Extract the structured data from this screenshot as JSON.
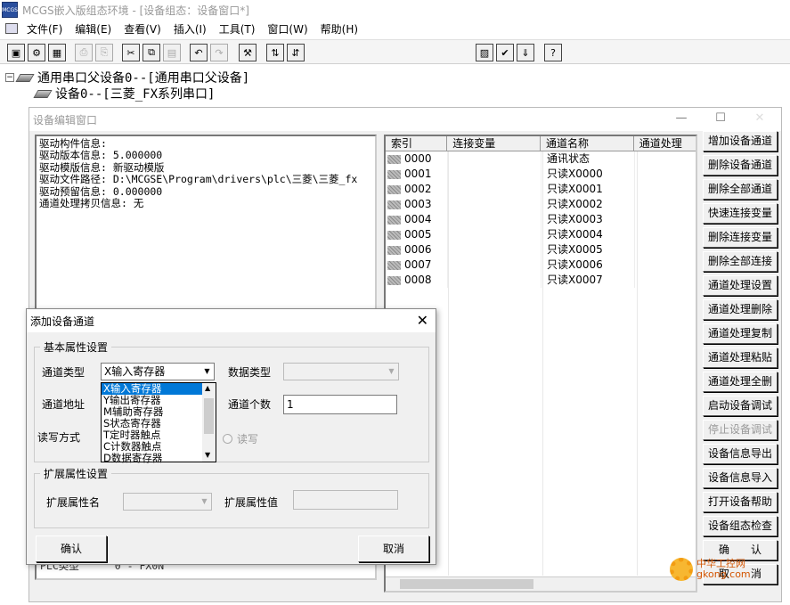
{
  "window": {
    "icon_text": "MCGS",
    "title": "MCGS嵌入版组态环境 - [设备组态：设备窗口*]"
  },
  "menu": [
    "文件(F)",
    "编辑(E)",
    "查看(V)",
    "插入(I)",
    "工具(T)",
    "窗口(W)",
    "帮助(H)"
  ],
  "toolbar": {
    "glyphs": [
      "▣",
      "⚙",
      "▦",
      "⎙",
      "⎘",
      "✂",
      "⧉",
      "▤",
      "↶",
      "↷",
      "⚒",
      "⇅",
      "⇵",
      "▨",
      "✔",
      "⇓",
      "?"
    ]
  },
  "tree": {
    "parent": "通用串口父设备0--[通用串口父设备]",
    "toggle": "−",
    "child": "设备0--[三菱_FX系列串口]"
  },
  "device_window": {
    "title": "设备编辑窗口",
    "minimize": "—",
    "maximize": "☐",
    "close": "✕",
    "driver_info": [
      "驱动构件信息:",
      "驱动版本信息: 5.000000",
      "驱动模版信息: 新驱动模版",
      "驱动文件路径: D:\\MCGSE\\Program\\drivers\\plc\\三菱\\三菱_fx",
      "驱动预留信息: 0.000000",
      "通道处理拷贝信息: 无"
    ],
    "hidden_row": {
      "label": "PLC类型",
      "value": "0 - FX0N"
    },
    "grid_headers": [
      "索引",
      "连接变量",
      "通道名称",
      "通道处理"
    ],
    "channels": [
      {
        "index": "0000",
        "var": "",
        "name": "通讯状态",
        "proc": ""
      },
      {
        "index": "0001",
        "var": "",
        "name": "只读X0000",
        "proc": ""
      },
      {
        "index": "0002",
        "var": "",
        "name": "只读X0001",
        "proc": ""
      },
      {
        "index": "0003",
        "var": "",
        "name": "只读X0002",
        "proc": ""
      },
      {
        "index": "0004",
        "var": "",
        "name": "只读X0003",
        "proc": ""
      },
      {
        "index": "0005",
        "var": "",
        "name": "只读X0004",
        "proc": ""
      },
      {
        "index": "0006",
        "var": "",
        "name": "只读X0005",
        "proc": ""
      },
      {
        "index": "0007",
        "var": "",
        "name": "只读X0006",
        "proc": ""
      },
      {
        "index": "0008",
        "var": "",
        "name": "只读X0007",
        "proc": ""
      }
    ],
    "buttons": [
      {
        "label": "增加设备通道",
        "enabled": true
      },
      {
        "label": "删除设备通道",
        "enabled": true
      },
      {
        "label": "删除全部通道",
        "enabled": true
      },
      {
        "label": "快速连接变量",
        "enabled": true
      },
      {
        "label": "删除连接变量",
        "enabled": true
      },
      {
        "label": "删除全部连接",
        "enabled": true
      },
      {
        "label": "通道处理设置",
        "enabled": true
      },
      {
        "label": "通道处理删除",
        "enabled": true
      },
      {
        "label": "通道处理复制",
        "enabled": true
      },
      {
        "label": "通道处理粘贴",
        "enabled": true
      },
      {
        "label": "通道处理全删",
        "enabled": true
      },
      {
        "label": "启动设备调试",
        "enabled": true
      },
      {
        "label": "停止设备调试",
        "enabled": false
      },
      {
        "label": "设备信息导出",
        "enabled": true
      },
      {
        "label": "设备信息导入",
        "enabled": true
      },
      {
        "label": "打开设备帮助",
        "enabled": true
      },
      {
        "label": "设备组态检查",
        "enabled": true
      },
      {
        "label": "确　　认",
        "enabled": true
      },
      {
        "label": "取　　消",
        "enabled": true
      }
    ]
  },
  "dialog": {
    "title": "添加设备通道",
    "close": "✕",
    "basic_group": "基本属性设置",
    "channel_type_label": "通道类型",
    "channel_type_value": "X输入寄存器",
    "data_type_label": "数据类型",
    "data_type_value": "",
    "channel_addr_label": "通道地址",
    "channel_count_label": "通道个数",
    "channel_count_value": "1",
    "rw_label": "读写方式",
    "rw_option": "读写",
    "dropdown_options": [
      "X输入寄存器",
      "Y输出寄存器",
      "M辅助寄存器",
      "S状态寄存器",
      "T定时器触点",
      "C计数器触点",
      "D数据寄存器"
    ],
    "ext_group": "扩展属性设置",
    "ext_name_label": "扩展属性名",
    "ext_value_label": "扩展属性值",
    "ok": "确认",
    "cancel": "取消"
  },
  "watermark": {
    "line1": "中华工控网",
    "line2": "gkong.com"
  }
}
